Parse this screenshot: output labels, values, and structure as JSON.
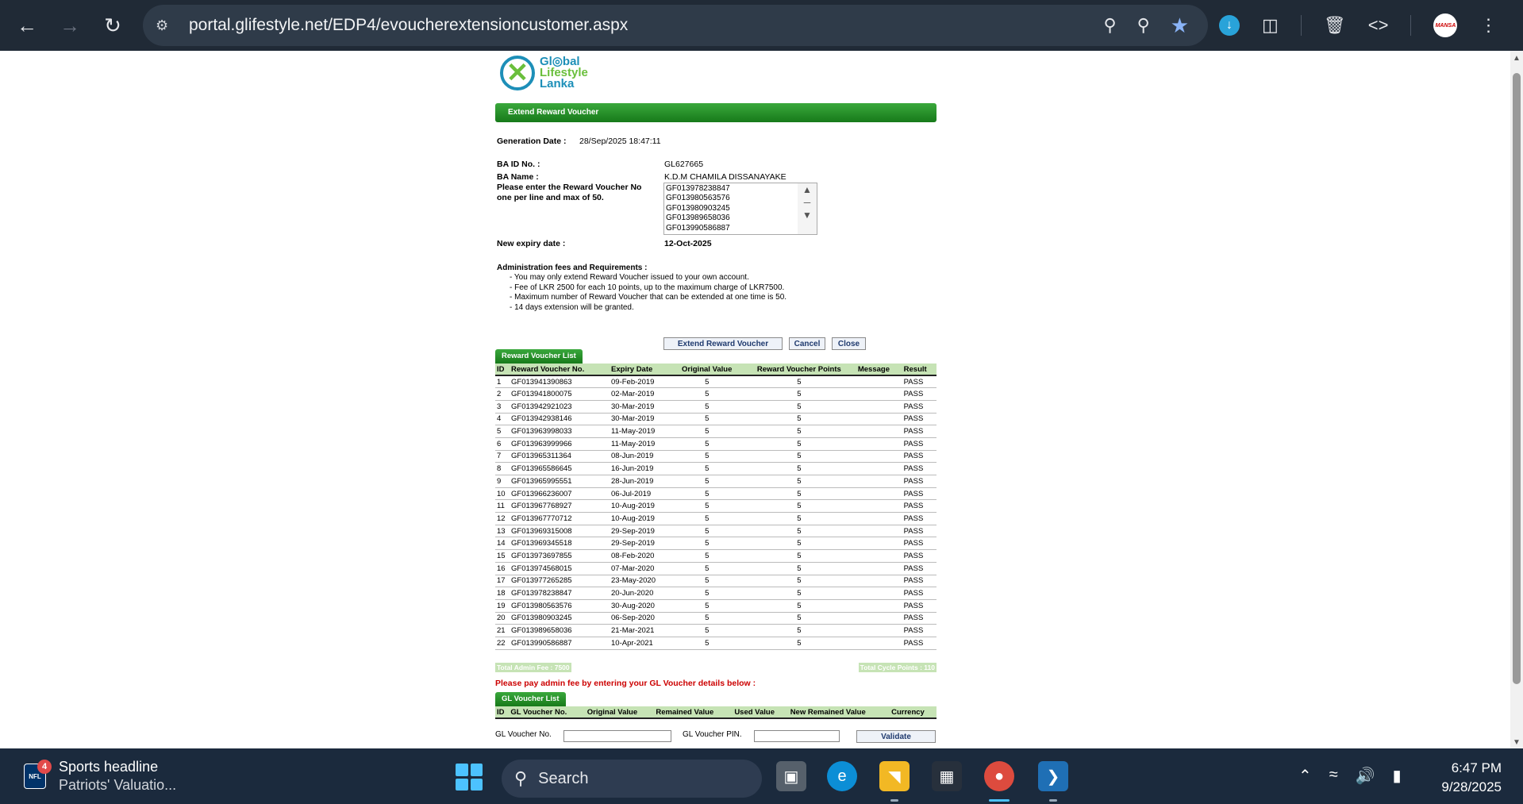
{
  "browser": {
    "url": "portal.glifestyle.net/EDP4/evoucherextensioncustomer.aspx",
    "profile_initial": "MANSA"
  },
  "logo": {
    "line1": "Gl◎bal",
    "line2": "Lifestyle",
    "line3": "Lanka"
  },
  "page": {
    "header": "Extend Reward Voucher",
    "generation_date_label": "Generation Date :",
    "generation_date": "28/Sep/2025 18:47:11",
    "ba_id_label": "BA ID No. :",
    "ba_id": "GL627665",
    "ba_name_label": "BA Name :",
    "ba_name": "K.D.M CHAMILA DISSANAYAKE",
    "voucher_prompt_1": "Please enter the Reward Voucher No",
    "voucher_prompt_2": "one per line and max of 50.",
    "voucher_lines": [
      "GF013978238847",
      "GF013980563576",
      "GF013980903245",
      "GF013989658036",
      "GF013990586887"
    ],
    "new_expiry_label": "New expiry date :",
    "new_expiry": "12-Oct-2025",
    "requirements_title": "Administration fees and Requirements :",
    "requirements": [
      "- You may only extend Reward Voucher issued to your own account.",
      "- Fee of LKR 2500 for each 10 points, up to the maximum charge of LKR7500.",
      "- Maximum number of Reward Voucher that can be extended at one time is 50.",
      "- 14 days extension will be granted."
    ],
    "buttons": {
      "extend": "Extend Reward Voucher",
      "cancel": "Cancel",
      "close": "Close"
    }
  },
  "reward_list": {
    "tab": "Reward Voucher List",
    "headers": [
      "ID",
      "Reward Voucher No.",
      "Expiry Date",
      "Original Value",
      "Reward Voucher Points",
      "Message",
      "Result"
    ],
    "rows": [
      [
        "1",
        "GF013941390863",
        "09-Feb-2019",
        "5",
        "5",
        "",
        "PASS"
      ],
      [
        "2",
        "GF013941800075",
        "02-Mar-2019",
        "5",
        "5",
        "",
        "PASS"
      ],
      [
        "3",
        "GF013942921023",
        "30-Mar-2019",
        "5",
        "5",
        "",
        "PASS"
      ],
      [
        "4",
        "GF013942938146",
        "30-Mar-2019",
        "5",
        "5",
        "",
        "PASS"
      ],
      [
        "5",
        "GF013963998033",
        "11-May-2019",
        "5",
        "5",
        "",
        "PASS"
      ],
      [
        "6",
        "GF013963999966",
        "11-May-2019",
        "5",
        "5",
        "",
        "PASS"
      ],
      [
        "7",
        "GF013965311364",
        "08-Jun-2019",
        "5",
        "5",
        "",
        "PASS"
      ],
      [
        "8",
        "GF013965586645",
        "16-Jun-2019",
        "5",
        "5",
        "",
        "PASS"
      ],
      [
        "9",
        "GF013965995551",
        "28-Jun-2019",
        "5",
        "5",
        "",
        "PASS"
      ],
      [
        "10",
        "GF013966236007",
        "06-Jul-2019",
        "5",
        "5",
        "",
        "PASS"
      ],
      [
        "11",
        "GF013967768927",
        "10-Aug-2019",
        "5",
        "5",
        "",
        "PASS"
      ],
      [
        "12",
        "GF013967770712",
        "10-Aug-2019",
        "5",
        "5",
        "",
        "PASS"
      ],
      [
        "13",
        "GF013969315008",
        "29-Sep-2019",
        "5",
        "5",
        "",
        "PASS"
      ],
      [
        "14",
        "GF013969345518",
        "29-Sep-2019",
        "5",
        "5",
        "",
        "PASS"
      ],
      [
        "15",
        "GF013973697855",
        "08-Feb-2020",
        "5",
        "5",
        "",
        "PASS"
      ],
      [
        "16",
        "GF013974568015",
        "07-Mar-2020",
        "5",
        "5",
        "",
        "PASS"
      ],
      [
        "17",
        "GF013977265285",
        "23-May-2020",
        "5",
        "5",
        "",
        "PASS"
      ],
      [
        "18",
        "GF013978238847",
        "20-Jun-2020",
        "5",
        "5",
        "",
        "PASS"
      ],
      [
        "19",
        "GF013980563576",
        "30-Aug-2020",
        "5",
        "5",
        "",
        "PASS"
      ],
      [
        "20",
        "GF013980903245",
        "06-Sep-2020",
        "5",
        "5",
        "",
        "PASS"
      ],
      [
        "21",
        "GF013989658036",
        "21-Mar-2021",
        "5",
        "5",
        "",
        "PASS"
      ],
      [
        "22",
        "GF013990586887",
        "10-Apr-2021",
        "5",
        "5",
        "",
        "PASS"
      ]
    ],
    "total_admin_fee": "Total Admin Fee : 7500",
    "total_cycle_points": "Total Cycle Points : 110"
  },
  "gl_section": {
    "pay_message": "Please pay admin fee by entering your GL Voucher details below :",
    "tab": "GL Voucher List",
    "headers": [
      "ID",
      "GL Voucher No.",
      "Original Value",
      "Remained Value",
      "Used Value",
      "New Remained Value",
      "Currency"
    ],
    "voucher_no_label": "GL Voucher No.",
    "voucher_pin_label": "GL Voucher PIN.",
    "validate": "Validate"
  },
  "taskbar": {
    "news_badge": "4",
    "news_title": "Sports headline",
    "news_sub": "Patriots' Valuatio...",
    "search_placeholder": "Search",
    "time": "6:47 PM",
    "date": "9/28/2025"
  }
}
